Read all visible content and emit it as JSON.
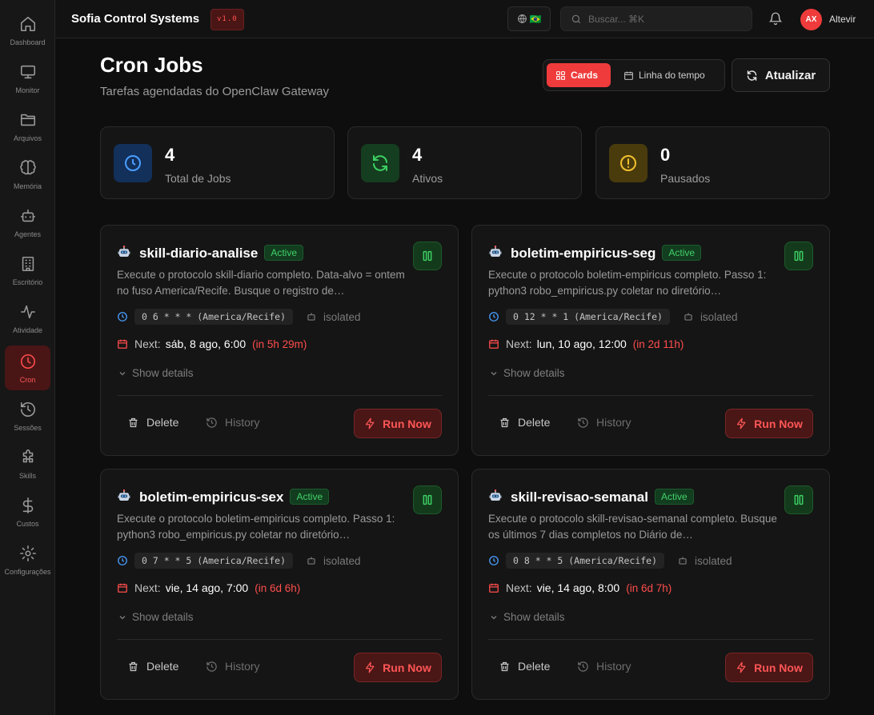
{
  "header": {
    "app_title": "Sofia Control Systems",
    "version": "v1.0",
    "flag": "🇧🇷",
    "search_placeholder": "Buscar... ⌘K",
    "avatar_initials": "AX",
    "username": "Altevir"
  },
  "sidebar": {
    "items": [
      {
        "label": "Dashboard",
        "icon": "home-icon"
      },
      {
        "label": "Monitor",
        "icon": "monitor-icon"
      },
      {
        "label": "Arquivos",
        "icon": "folder-icon"
      },
      {
        "label": "Memória",
        "icon": "brain-icon"
      },
      {
        "label": "Agentes",
        "icon": "bot-icon"
      },
      {
        "label": "Escritório",
        "icon": "building-icon"
      },
      {
        "label": "Atividade",
        "icon": "activity-icon"
      },
      {
        "label": "Cron",
        "icon": "clock-icon",
        "active": true
      },
      {
        "label": "Sessões",
        "icon": "history-icon"
      },
      {
        "label": "Skills",
        "icon": "puzzle-icon"
      },
      {
        "label": "Custos",
        "icon": "dollar-icon"
      },
      {
        "label": "Configurações",
        "icon": "gear-icon"
      }
    ]
  },
  "page": {
    "title": "Cron Jobs",
    "subtitle": "Tarefas agendadas do OpenClaw Gateway",
    "view_cards": "Cards",
    "view_timeline": "Linha do tempo",
    "refresh_label": "Atualizar"
  },
  "stats": [
    {
      "value": "4",
      "label": "Total de Jobs",
      "icon": "clock-icon",
      "color": "#4a9eff",
      "bg": "#12305a"
    },
    {
      "value": "4",
      "label": "Ativos",
      "icon": "refresh-icon",
      "color": "#3ccf63",
      "bg": "#153d1f"
    },
    {
      "value": "0",
      "label": "Pausados",
      "icon": "alert-icon",
      "color": "#f2c12e",
      "bg": "#4a3b0d"
    }
  ],
  "jobs": [
    {
      "name": "skill-diario-analise",
      "status": "Active",
      "description": "Execute o protocolo skill-diario completo. Data-alvo = ontem no fuso America/Recife. Busque o registro de…",
      "schedule": "0 6 * * * (America/Recife)",
      "session": "isolated",
      "next_label": "Next:",
      "next_run": "sáb, 8 ago, 6:00",
      "next_relative": "(in 5h 29m)"
    },
    {
      "name": "boletim-empiricus-seg",
      "status": "Active",
      "description": "Execute o protocolo boletim-empiricus completo. Passo 1: python3 robo_empiricus.py coletar no diretório…",
      "schedule": "0 12 * * 1 (America/Recife)",
      "session": "isolated",
      "next_label": "Next:",
      "next_run": "lun, 10 ago, 12:00",
      "next_relative": "(in 2d 11h)"
    },
    {
      "name": "boletim-empiricus-sex",
      "status": "Active",
      "description": "Execute o protocolo boletim-empiricus completo. Passo 1: python3 robo_empiricus.py coletar no diretório…",
      "schedule": "0 7 * * 5 (America/Recife)",
      "session": "isolated",
      "next_label": "Next:",
      "next_run": "vie, 14 ago, 7:00",
      "next_relative": "(in 6d 6h)"
    },
    {
      "name": "skill-revisao-semanal",
      "status": "Active",
      "description": "Execute o protocolo skill-revisao-semanal completo. Busque os últimos 7 dias completos no Diário de…",
      "schedule": "0 8 * * 5 (America/Recife)",
      "session": "isolated",
      "next_label": "Next:",
      "next_run": "vie, 14 ago, 8:00",
      "next_relative": "(in 6d 7h)"
    }
  ],
  "card_labels": {
    "show_details": "Show details",
    "delete": "Delete",
    "history": "History",
    "run_now": "Run Now"
  }
}
